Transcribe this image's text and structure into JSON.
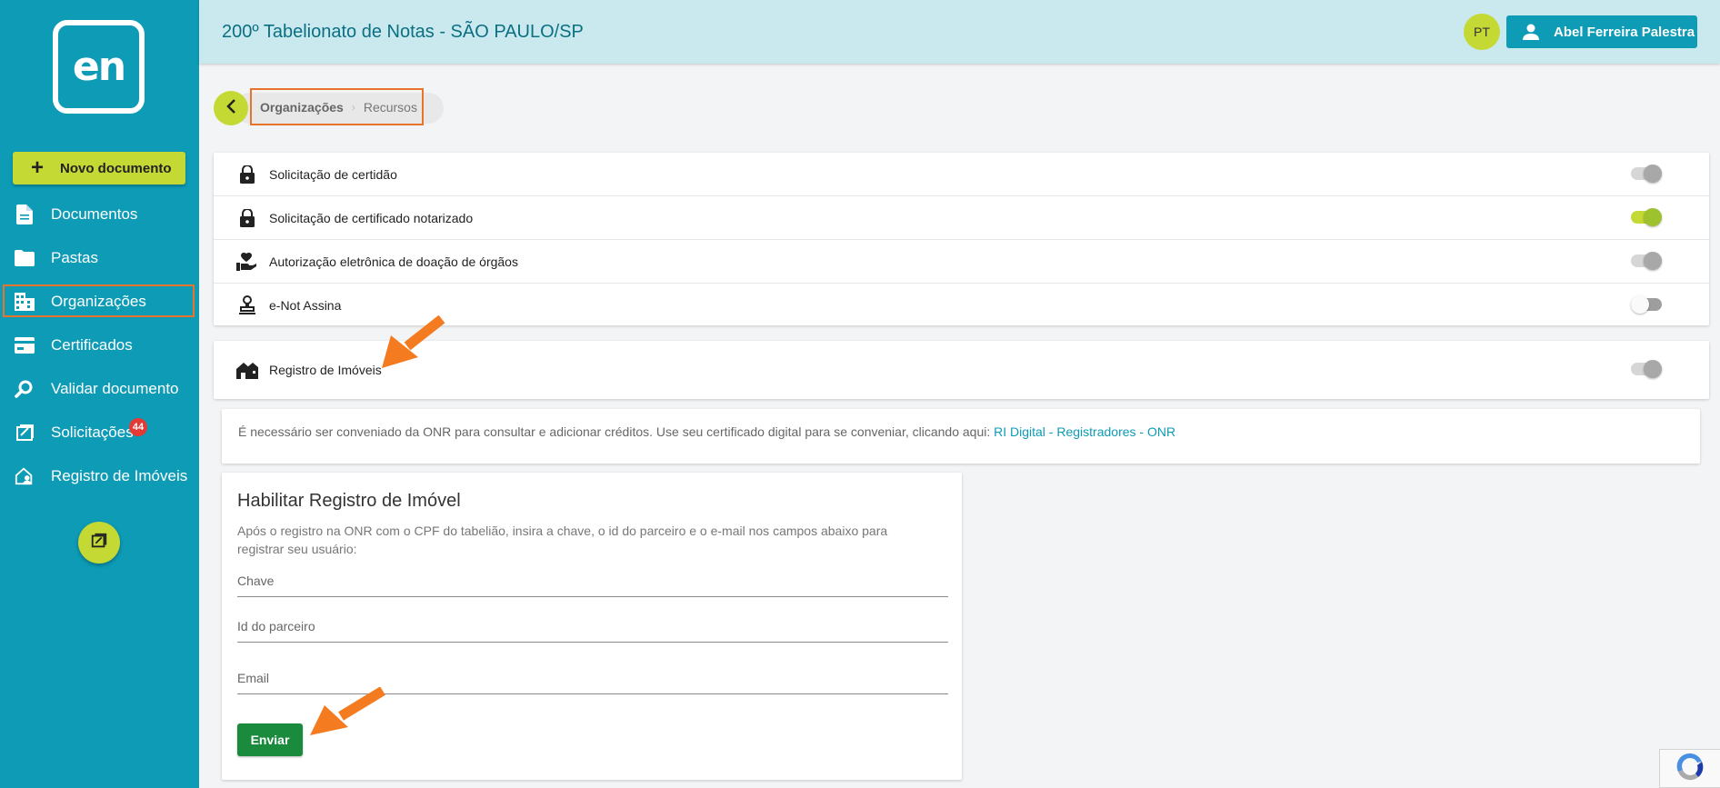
{
  "header": {
    "title": "200º Tabelionato de Notas - SÃO PAULO/SP",
    "avatar_initials": "PT",
    "user_name": "Abel Ferreira Palestra"
  },
  "sidebar": {
    "logo_text": "en",
    "new_document_label": "Novo documento",
    "items": [
      {
        "label": "Documentos",
        "icon": "document-icon"
      },
      {
        "label": "Pastas",
        "icon": "folder-icon"
      },
      {
        "label": "Organizações",
        "icon": "building-icon",
        "active": true
      },
      {
        "label": "Certificados",
        "icon": "certificate-card-icon"
      },
      {
        "label": "Validar documento",
        "icon": "search-document-icon"
      },
      {
        "label": "Solicitações",
        "icon": "request-icon",
        "badge": "44"
      },
      {
        "label": "Registro de Imóveis",
        "icon": "house-user-icon"
      }
    ]
  },
  "breadcrumb": {
    "items": [
      "Organizações",
      "Recursos"
    ]
  },
  "resources": [
    {
      "label": "Solicitação de certidão",
      "icon": "lock-icon",
      "state": "disabled-on"
    },
    {
      "label": "Solicitação de certificado notarizado",
      "icon": "lock-icon",
      "state": "on"
    },
    {
      "label": "Autorização eletrônica de doação de órgãos",
      "icon": "hand-heart-icon",
      "state": "disabled-on"
    },
    {
      "label": "e-Not Assina",
      "icon": "stamp-icon",
      "state": "off"
    }
  ],
  "registro": {
    "label": "Registro de Imóveis",
    "icon": "houses-icon",
    "state": "disabled-on"
  },
  "info": {
    "text": "É necessário ser conveniado da ONR para consultar e adicionar créditos. Use seu certificado digital para se conveniar, clicando aqui: ",
    "link": "RI Digital - Registradores - ONR"
  },
  "form": {
    "title": "Habilitar Registro de Imóvel",
    "description": "Após o registro na ONR com o CPF do tabelião, insira a chave, o id do parceiro e o e-mail nos campos abaixo para registrar seu usuário:",
    "fields": {
      "chave": "Chave",
      "parceiro": "Id do parceiro",
      "email": "Email"
    },
    "submit_label": "Enviar"
  },
  "colors": {
    "sidebar": "#0e9bb6",
    "accent": "#c5d934",
    "highlight": "#e8742b",
    "submit": "#1a8a3c"
  }
}
